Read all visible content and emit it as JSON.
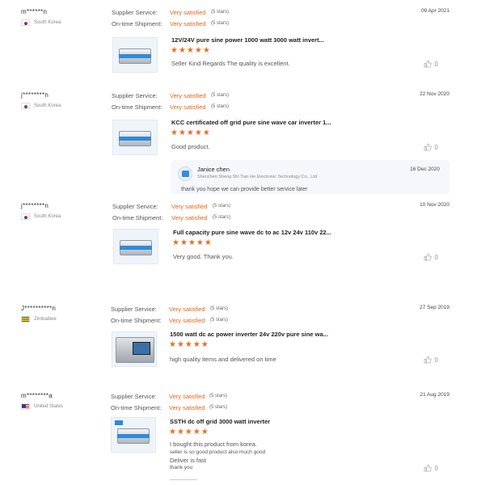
{
  "labels": {
    "supplier_service": "Supplier Service:",
    "on_time_shipment": "On-time Shipment:"
  },
  "colors": {
    "accent": "#e8641b",
    "stars": "#f26b1d"
  },
  "reviews": [
    {
      "user": "m******n",
      "country": "South Korea",
      "flag": "kr-flag-icon",
      "date": "09 Apr 2021",
      "supplier_rating": "Very satisfied",
      "supplier_stars": "(5 stars)",
      "shipment_rating": "Very satisfied",
      "shipment_stars": "(5 stars)",
      "product_title": "12V/24V pure sine power 1000 watt 3000 watt invert...",
      "stars": "★★★★★",
      "stars_value": 5,
      "comment": "Seller Kind Regards The quality is excellent.",
      "likes": "0"
    },
    {
      "user": "j********n",
      "country": "South Korea",
      "flag": "kr-flag-icon",
      "date": "22 Nov 2020",
      "supplier_rating": "Very satisfied",
      "supplier_stars": "(5 stars)",
      "shipment_rating": "Very satisfied",
      "shipment_stars": "(5 stars)",
      "product_title": "KCC certificated off grid pure sine wave car inverter 1...",
      "stars": "★★★★★",
      "stars_value": 5,
      "comment": "Good product.",
      "likes": "0",
      "reply": {
        "name": "Janice chen",
        "company": "Shenzhen Sheng Shi Tian He Electronic Technology Co., Ltd.",
        "date": "16 Dec 2020",
        "text": "thank you  hope we can provide better service later"
      }
    },
    {
      "user": "j********n",
      "country": "South Korea",
      "flag": "kr-flag-icon",
      "date": "10 Nov 2020",
      "supplier_rating": "Very satisfied",
      "supplier_stars": "(5 stars)",
      "shipment_rating": "Very satisfied",
      "shipment_stars": "(5 stars)",
      "product_title": "Full capacity pure sine wave dc to ac 12v 24v 110v 22...",
      "stars": "★★★★★",
      "stars_value": 5,
      "comment": "Very good. Thank you.",
      "likes": "0"
    },
    {
      "user": "J**********n",
      "country": "Zimbabwe",
      "flag": "zw-flag-icon",
      "date": "27 Sep 2019",
      "supplier_rating": "Very satisfied",
      "supplier_stars": "(5 stars)",
      "shipment_rating": "Very satisfied",
      "shipment_stars": "(5 stars)",
      "product_title": "1500 watt dc ac power inverter 24v 220v pure sine wa...",
      "stars": "★★★★★",
      "stars_value": 5,
      "comment": "high quality items and delivered on time",
      "likes": "0"
    },
    {
      "user": "m********a",
      "country": "United States",
      "flag": "us-flag-icon",
      "date": "21 Aug 2019",
      "supplier_rating": "Very satisfied",
      "supplier_stars": "(5 stars)",
      "shipment_rating": "Very satisfied",
      "shipment_stars": "(5 stars)",
      "product_title": "SSTH dc off grid 3000 watt inverter",
      "stars": "★★★★★",
      "stars_value": 5,
      "comment": "I bought this product from korea.",
      "comment_lines": [
        "seller is so good product also much good",
        "Deliver is fast",
        "thank you"
      ],
      "likes": "0"
    }
  ]
}
